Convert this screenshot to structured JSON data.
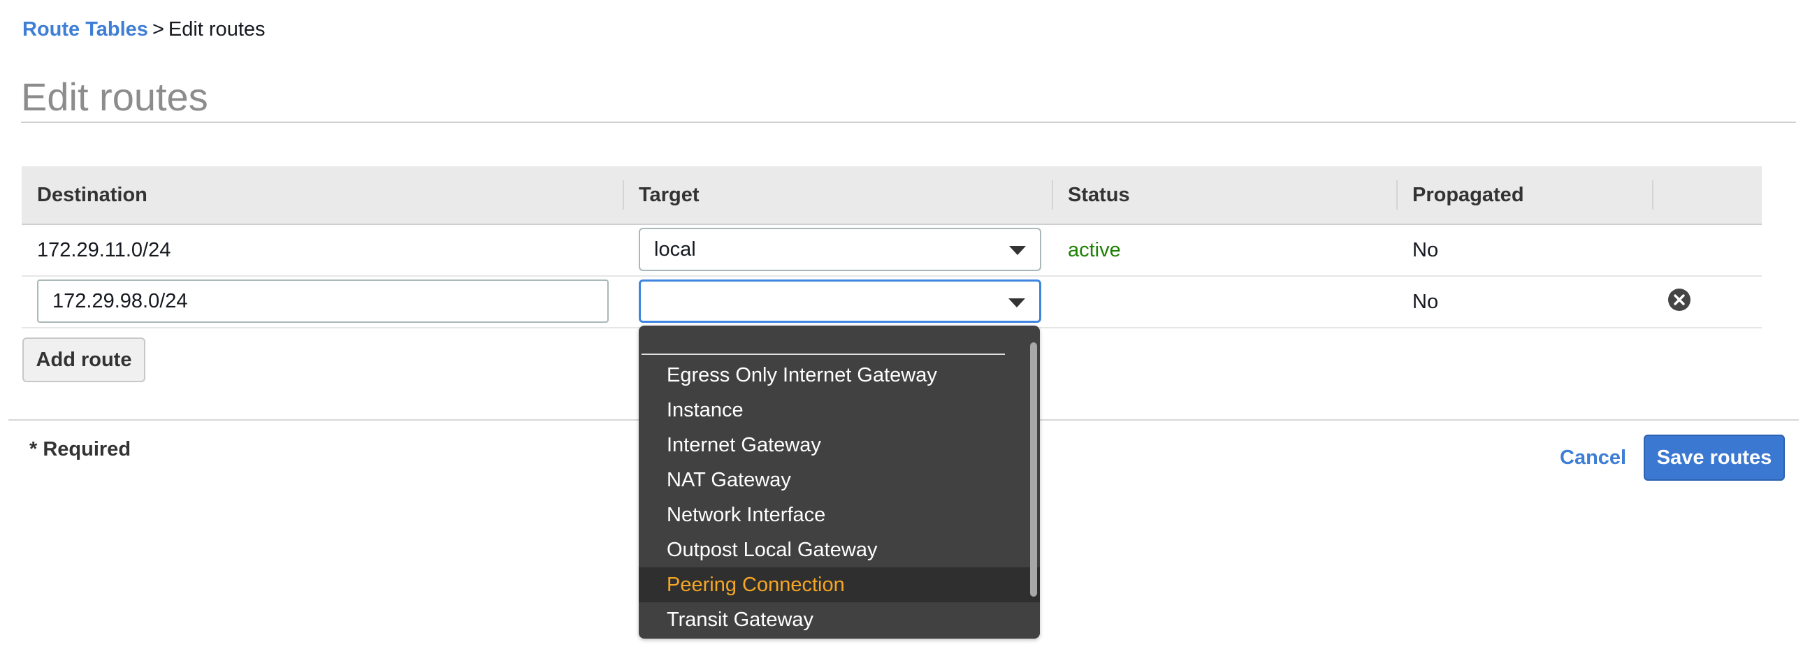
{
  "breadcrumb": {
    "parent": "Route Tables",
    "separator": ">",
    "current": "Edit routes"
  },
  "page_title": "Edit routes",
  "table": {
    "columns": [
      "Destination",
      "Target",
      "Status",
      "Propagated"
    ],
    "rows": [
      {
        "destination": "172.29.11.0/24",
        "target": "local",
        "status": "active",
        "propagated": "No"
      },
      {
        "destination": "172.29.98.0/24",
        "target": "",
        "status": "",
        "propagated": "No"
      }
    ]
  },
  "buttons": {
    "add_route": "Add route",
    "cancel": "Cancel",
    "save_routes": "Save routes"
  },
  "footer": {
    "required": "* Required"
  },
  "dropdown": {
    "options": [
      "Egress Only Internet Gateway",
      "Instance",
      "Internet Gateway",
      "NAT Gateway",
      "Network Interface",
      "Outpost Local Gateway",
      "Peering Connection",
      "Transit Gateway"
    ],
    "highlighted": "Peering Connection"
  },
  "colors": {
    "link": "#3f7ed5",
    "status_active": "#1d8102",
    "primary_button": "#3a78d2",
    "dropdown_bg": "#414141",
    "dropdown_highlight": "#f5a623"
  },
  "icons": {
    "remove": "x-circle-icon",
    "select_caret": "caret-down-icon"
  }
}
